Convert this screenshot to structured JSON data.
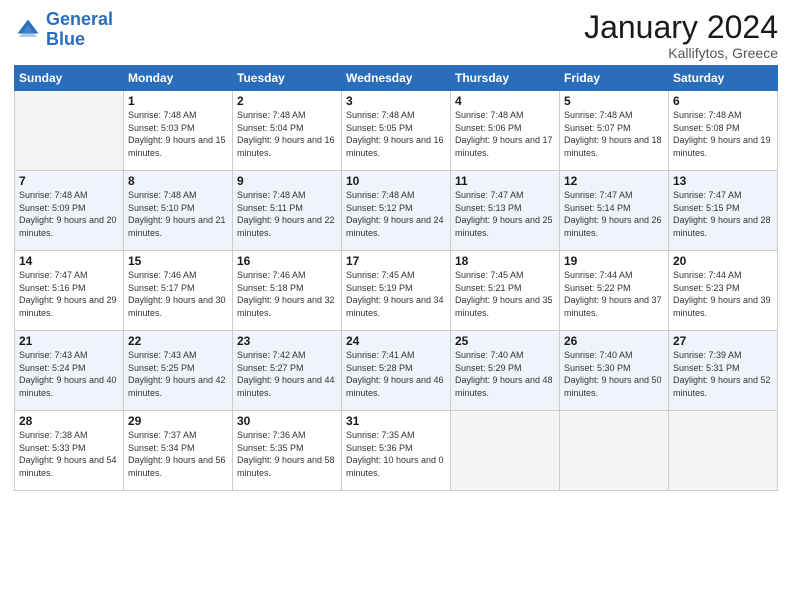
{
  "header": {
    "logo_line1": "General",
    "logo_line2": "Blue",
    "title": "January 2024",
    "subtitle": "Kallifytos, Greece"
  },
  "weekdays": [
    "Sunday",
    "Monday",
    "Tuesday",
    "Wednesday",
    "Thursday",
    "Friday",
    "Saturday"
  ],
  "weeks": [
    [
      {
        "day": "",
        "sunrise": "",
        "sunset": "",
        "daylight": ""
      },
      {
        "day": "1",
        "sunrise": "Sunrise: 7:48 AM",
        "sunset": "Sunset: 5:03 PM",
        "daylight": "Daylight: 9 hours and 15 minutes."
      },
      {
        "day": "2",
        "sunrise": "Sunrise: 7:48 AM",
        "sunset": "Sunset: 5:04 PM",
        "daylight": "Daylight: 9 hours and 16 minutes."
      },
      {
        "day": "3",
        "sunrise": "Sunrise: 7:48 AM",
        "sunset": "Sunset: 5:05 PM",
        "daylight": "Daylight: 9 hours and 16 minutes."
      },
      {
        "day": "4",
        "sunrise": "Sunrise: 7:48 AM",
        "sunset": "Sunset: 5:06 PM",
        "daylight": "Daylight: 9 hours and 17 minutes."
      },
      {
        "day": "5",
        "sunrise": "Sunrise: 7:48 AM",
        "sunset": "Sunset: 5:07 PM",
        "daylight": "Daylight: 9 hours and 18 minutes."
      },
      {
        "day": "6",
        "sunrise": "Sunrise: 7:48 AM",
        "sunset": "Sunset: 5:08 PM",
        "daylight": "Daylight: 9 hours and 19 minutes."
      }
    ],
    [
      {
        "day": "7",
        "sunrise": "Sunrise: 7:48 AM",
        "sunset": "Sunset: 5:09 PM",
        "daylight": "Daylight: 9 hours and 20 minutes."
      },
      {
        "day": "8",
        "sunrise": "Sunrise: 7:48 AM",
        "sunset": "Sunset: 5:10 PM",
        "daylight": "Daylight: 9 hours and 21 minutes."
      },
      {
        "day": "9",
        "sunrise": "Sunrise: 7:48 AM",
        "sunset": "Sunset: 5:11 PM",
        "daylight": "Daylight: 9 hours and 22 minutes."
      },
      {
        "day": "10",
        "sunrise": "Sunrise: 7:48 AM",
        "sunset": "Sunset: 5:12 PM",
        "daylight": "Daylight: 9 hours and 24 minutes."
      },
      {
        "day": "11",
        "sunrise": "Sunrise: 7:47 AM",
        "sunset": "Sunset: 5:13 PM",
        "daylight": "Daylight: 9 hours and 25 minutes."
      },
      {
        "day": "12",
        "sunrise": "Sunrise: 7:47 AM",
        "sunset": "Sunset: 5:14 PM",
        "daylight": "Daylight: 9 hours and 26 minutes."
      },
      {
        "day": "13",
        "sunrise": "Sunrise: 7:47 AM",
        "sunset": "Sunset: 5:15 PM",
        "daylight": "Daylight: 9 hours and 28 minutes."
      }
    ],
    [
      {
        "day": "14",
        "sunrise": "Sunrise: 7:47 AM",
        "sunset": "Sunset: 5:16 PM",
        "daylight": "Daylight: 9 hours and 29 minutes."
      },
      {
        "day": "15",
        "sunrise": "Sunrise: 7:46 AM",
        "sunset": "Sunset: 5:17 PM",
        "daylight": "Daylight: 9 hours and 30 minutes."
      },
      {
        "day": "16",
        "sunrise": "Sunrise: 7:46 AM",
        "sunset": "Sunset: 5:18 PM",
        "daylight": "Daylight: 9 hours and 32 minutes."
      },
      {
        "day": "17",
        "sunrise": "Sunrise: 7:45 AM",
        "sunset": "Sunset: 5:19 PM",
        "daylight": "Daylight: 9 hours and 34 minutes."
      },
      {
        "day": "18",
        "sunrise": "Sunrise: 7:45 AM",
        "sunset": "Sunset: 5:21 PM",
        "daylight": "Daylight: 9 hours and 35 minutes."
      },
      {
        "day": "19",
        "sunrise": "Sunrise: 7:44 AM",
        "sunset": "Sunset: 5:22 PM",
        "daylight": "Daylight: 9 hours and 37 minutes."
      },
      {
        "day": "20",
        "sunrise": "Sunrise: 7:44 AM",
        "sunset": "Sunset: 5:23 PM",
        "daylight": "Daylight: 9 hours and 39 minutes."
      }
    ],
    [
      {
        "day": "21",
        "sunrise": "Sunrise: 7:43 AM",
        "sunset": "Sunset: 5:24 PM",
        "daylight": "Daylight: 9 hours and 40 minutes."
      },
      {
        "day": "22",
        "sunrise": "Sunrise: 7:43 AM",
        "sunset": "Sunset: 5:25 PM",
        "daylight": "Daylight: 9 hours and 42 minutes."
      },
      {
        "day": "23",
        "sunrise": "Sunrise: 7:42 AM",
        "sunset": "Sunset: 5:27 PM",
        "daylight": "Daylight: 9 hours and 44 minutes."
      },
      {
        "day": "24",
        "sunrise": "Sunrise: 7:41 AM",
        "sunset": "Sunset: 5:28 PM",
        "daylight": "Daylight: 9 hours and 46 minutes."
      },
      {
        "day": "25",
        "sunrise": "Sunrise: 7:40 AM",
        "sunset": "Sunset: 5:29 PM",
        "daylight": "Daylight: 9 hours and 48 minutes."
      },
      {
        "day": "26",
        "sunrise": "Sunrise: 7:40 AM",
        "sunset": "Sunset: 5:30 PM",
        "daylight": "Daylight: 9 hours and 50 minutes."
      },
      {
        "day": "27",
        "sunrise": "Sunrise: 7:39 AM",
        "sunset": "Sunset: 5:31 PM",
        "daylight": "Daylight: 9 hours and 52 minutes."
      }
    ],
    [
      {
        "day": "28",
        "sunrise": "Sunrise: 7:38 AM",
        "sunset": "Sunset: 5:33 PM",
        "daylight": "Daylight: 9 hours and 54 minutes."
      },
      {
        "day": "29",
        "sunrise": "Sunrise: 7:37 AM",
        "sunset": "Sunset: 5:34 PM",
        "daylight": "Daylight: 9 hours and 56 minutes."
      },
      {
        "day": "30",
        "sunrise": "Sunrise: 7:36 AM",
        "sunset": "Sunset: 5:35 PM",
        "daylight": "Daylight: 9 hours and 58 minutes."
      },
      {
        "day": "31",
        "sunrise": "Sunrise: 7:35 AM",
        "sunset": "Sunset: 5:36 PM",
        "daylight": "Daylight: 10 hours and 0 minutes."
      },
      {
        "day": "",
        "sunrise": "",
        "sunset": "",
        "daylight": ""
      },
      {
        "day": "",
        "sunrise": "",
        "sunset": "",
        "daylight": ""
      },
      {
        "day": "",
        "sunrise": "",
        "sunset": "",
        "daylight": ""
      }
    ]
  ]
}
